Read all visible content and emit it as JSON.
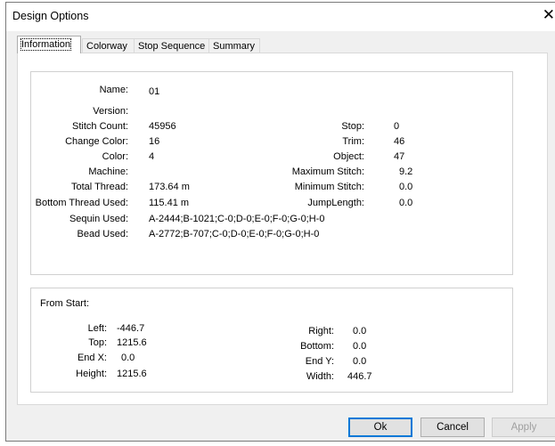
{
  "dialog": {
    "title": "Design Options",
    "close_glyph": "✕"
  },
  "tabs": [
    {
      "label": "Information",
      "active": true
    },
    {
      "label": "Colorway",
      "active": false
    },
    {
      "label": "Stop Sequence",
      "active": false
    },
    {
      "label": "Summary",
      "active": false
    }
  ],
  "info": {
    "name_label": "Name:",
    "name": "01",
    "version_label": "Version:",
    "version": "",
    "stitch_count_label": "Stitch Count:",
    "stitch_count": "45956",
    "change_color_label": "Change Color:",
    "change_color": "16",
    "color_label": "Color:",
    "color": "4",
    "machine_label": "Machine:",
    "machine": "",
    "total_thread_label": "Total Thread:",
    "total_thread": "173.64 m",
    "bottom_thread_label": "Bottom Thread Used:",
    "bottom_thread": "115.41 m",
    "sequin_label": "Sequin Used:",
    "sequin": "A-2444;B-1021;C-0;D-0;E-0;F-0;G-0;H-0",
    "bead_label": "Bead Used:",
    "bead": "A-2772;B-707;C-0;D-0;E-0;F-0;G-0;H-0",
    "stop_label": "Stop:",
    "stop": "0",
    "trim_label": "Trim:",
    "trim": "46",
    "object_label": "Object:",
    "object": "47",
    "max_stitch_label": "Maximum Stitch:",
    "max_stitch": "9.2",
    "min_stitch_label": "Minimum Stitch:",
    "min_stitch": "0.0",
    "jump_length_label": "JumpLength:",
    "jump_length": "0.0"
  },
  "from_start": {
    "heading": "From Start:",
    "left_label": "Left:",
    "left": "-446.7",
    "top_label": "Top:",
    "top": "1215.6",
    "endx_label": "End X:",
    "endx": "0.0",
    "height_label": "Height:",
    "height": "1215.6",
    "right_label": "Right:",
    "right": "0.0",
    "bottom_label": "Bottom:",
    "bottom": "0.0",
    "endy_label": "End Y:",
    "endy": "0.0",
    "width_label": "Width:",
    "width": "446.7"
  },
  "buttons": {
    "ok": "Ok",
    "cancel": "Cancel",
    "apply": "Apply"
  }
}
